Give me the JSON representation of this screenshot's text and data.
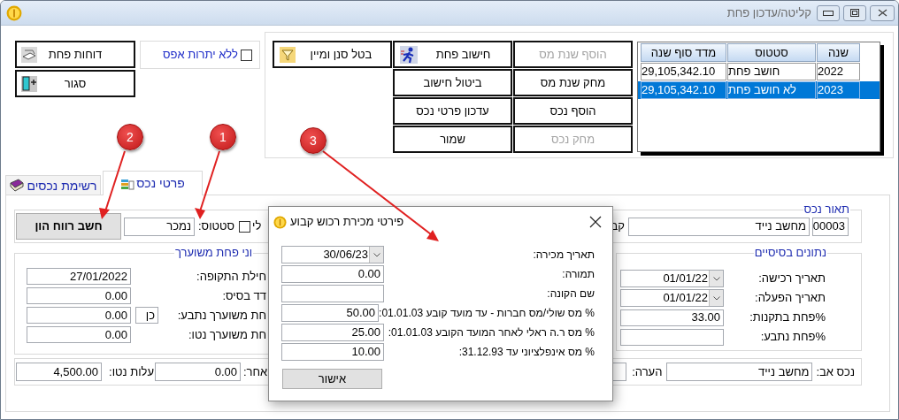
{
  "window": {
    "title": "קליטה/עדכון פחת"
  },
  "side_buttons": [
    "דוחות פחת",
    "סגור"
  ],
  "zero_balance": {
    "label": "ללא יתרות אפס",
    "checked": false
  },
  "filter_button": "בטל סנן ומיין",
  "action_columns": [
    [
      {
        "label": "הוסף שנת מס",
        "disabled": true
      },
      {
        "label": "מחק שנת מס",
        "disabled": false
      },
      {
        "label": "הוסף נכס",
        "disabled": false
      },
      {
        "label": "מחק נכס",
        "disabled": true
      }
    ],
    [
      {
        "label": "חישוב פחת",
        "disabled": false
      },
      {
        "label": "ביטול חישוב",
        "disabled": false
      },
      {
        "label": "עדכון פרטי נכס",
        "disabled": false
      },
      {
        "label": "שמור",
        "disabled": false
      }
    ]
  ],
  "years_table": {
    "columns": [
      "שנה",
      "סטטוס",
      "מדד סוף שנה"
    ],
    "rows": [
      {
        "cells": [
          "2022",
          "חושב פחת",
          "29,105,342.10"
        ],
        "selected": false
      },
      {
        "cells": [
          "2023",
          "לא חושב פחת",
          "29,105,342.10"
        ],
        "selected": true
      }
    ]
  },
  "tabs": [
    {
      "label": "פרטי נכס",
      "selected": true
    },
    {
      "label": "רשימת נכסים",
      "selected": false
    }
  ],
  "asset": {
    "legend": "תאור נכס",
    "code": "00003",
    "name": "מחשב נייד",
    "cut_label": "קב",
    "flag_label": "לי",
    "flag_checked": false,
    "status_label": "סטטוס:",
    "status": "נמכר",
    "capital_gain_button": "חשב רווח הון"
  },
  "basic_data": {
    "legend": "נתונים בסיסיים",
    "rows": [
      {
        "label": "תאריך רכישה:",
        "value": "01/01/22",
        "kind": "combo"
      },
      {
        "label": "תאריך הפעלה:",
        "value": "01/01/22",
        "kind": "combo"
      },
      {
        "label": "%פחת בתקנות:",
        "value": "33.00",
        "kind": "field"
      },
      {
        "label": "%פחת נתבע:",
        "kind": "field"
      }
    ]
  },
  "revalued": {
    "legend": "וני פחת משוערך",
    "rows": [
      {
        "label": "חילת התקופה:",
        "value": "27/01/2022"
      },
      {
        "label": "דד בסיס:",
        "value": "0.00"
      },
      {
        "label": "חת משוערך נתבע:",
        "value": "0.00",
        "flag": "כן"
      },
      {
        "label": "חת משוערך נטו:",
        "value": "0.00"
      }
    ]
  },
  "footer": {
    "parent_label": "נכס אב:",
    "parent": "מחשב נייד",
    "note_label": "הערה:",
    "other_label": "אחר:",
    "other": "0.00",
    "net_cost_label": "עלות נטו:",
    "net_cost": "4,500.00"
  },
  "dialog": {
    "title": "פירטי מכירת רכוש קבוע",
    "rows": [
      {
        "label": "תאריך מכירה:",
        "value": "30/06/23",
        "kind": "combo"
      },
      {
        "label": "תמורה:",
        "value": "0.00",
        "kind": "field"
      },
      {
        "label": "שם הקונה:",
        "kind": "field"
      },
      {
        "label": "% מס שולי/מס חברות - עד מועד קובע 01.01.03:",
        "value": "50.00",
        "kind": "field"
      },
      {
        "label": "% מס ר.ה ראלי לאחר המועד הקובע 01.01.03:",
        "value": "25.00",
        "kind": "field"
      },
      {
        "label": "% מס אינפלציוני עד 31.12.93:",
        "value": "10.00",
        "kind": "field"
      }
    ],
    "ok_button": "אישור"
  },
  "annotations": [
    {
      "label": "1"
    },
    {
      "label": "2"
    },
    {
      "label": "3"
    }
  ]
}
